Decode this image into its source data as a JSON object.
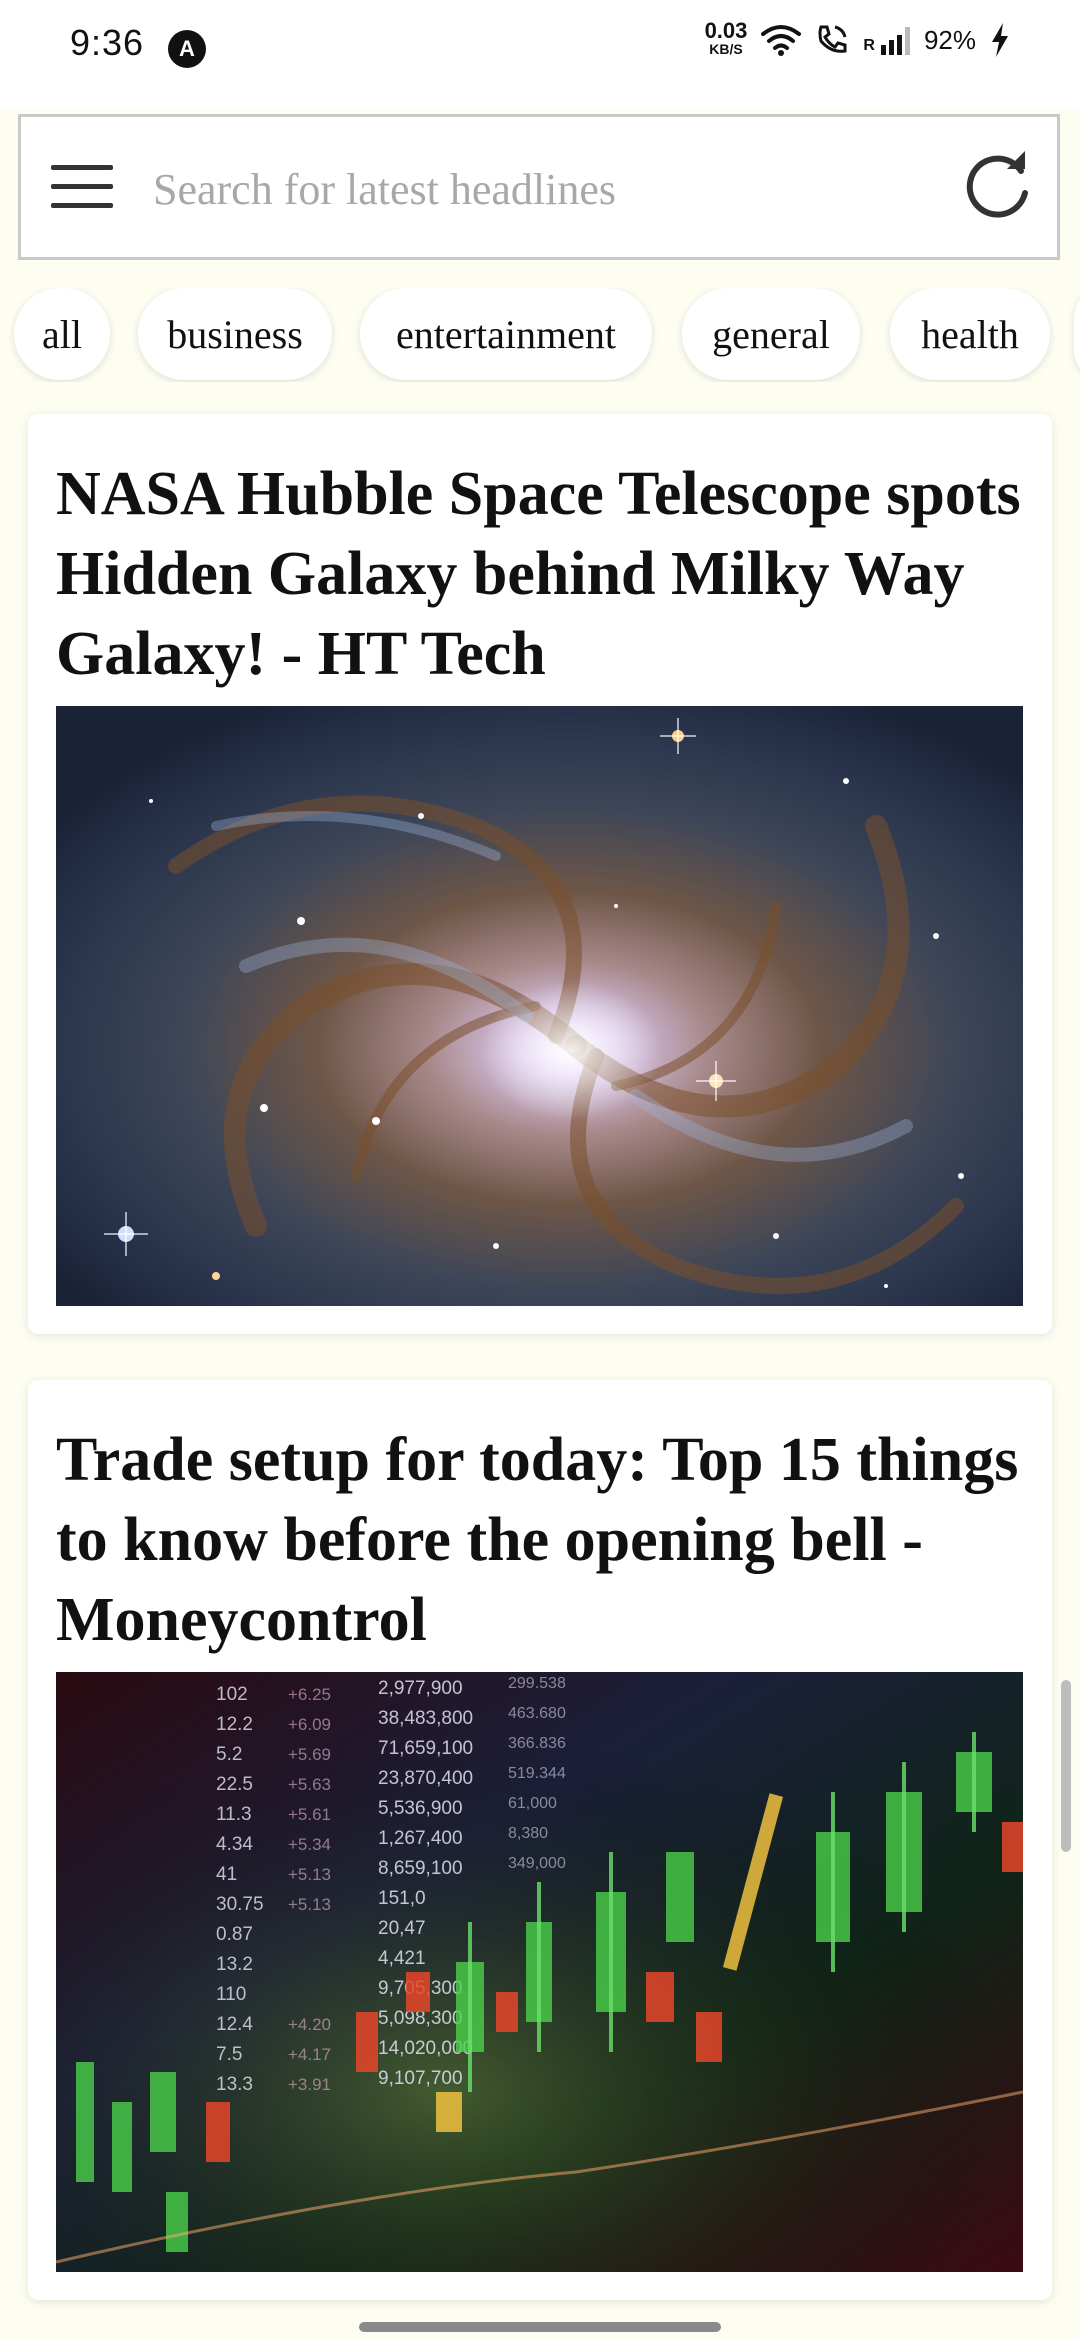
{
  "status_bar": {
    "time": "9:36",
    "app_icon": "A",
    "net_speed_value": "0.03",
    "net_speed_unit": "KB/S",
    "signal_label": "R",
    "battery": "92%"
  },
  "search": {
    "placeholder": "Search for latest headlines",
    "menu_icon": "hamburger-menu-icon",
    "refresh_icon": "refresh-icon"
  },
  "categories": [
    "all",
    "business",
    "entertainment",
    "general",
    "health"
  ],
  "articles": [
    {
      "title": "NASA Hubble Space Telescope spots Hidden Galaxy behind Milky Way Galaxy! - HT Tech",
      "image": "galaxy-image"
    },
    {
      "title": "Trade setup for today: Top 15 things to know before the opening bell - Moneycontrol",
      "image": "stock-market-image"
    }
  ],
  "stock_ticker": {
    "col1": [
      "102",
      "12.2",
      "5.2",
      "22.5",
      "11.3",
      "4.34",
      "41",
      "30.75",
      "0.87",
      "13.2",
      "110",
      "12.4",
      "7.5",
      "13.3"
    ],
    "col2": [
      "+6.25",
      "+6.09",
      "+5.69",
      "+5.63",
      "+5.61",
      "+5.34",
      "+5.13",
      "+5.13",
      "",
      "",
      "",
      "+4.20",
      "+4.17",
      "+3.91"
    ],
    "col3": [
      "2,977,900",
      "38,483,800",
      "71,659,100",
      "23,870,400",
      "5,536,900",
      "1,267,400",
      "8,659,100",
      "151,0",
      "20,47",
      "4,421",
      "9,705,300",
      "5,098,300",
      "14,020,000",
      "9,107,700"
    ],
    "col4": [
      "299.538",
      "463.680",
      "366.836",
      "519.344",
      "61,000",
      "8,380",
      "349,000"
    ]
  },
  "colors": {
    "background": "#fdfdf1",
    "card": "#ffffff",
    "text": "#111111",
    "placeholder": "#a8a8a8"
  }
}
